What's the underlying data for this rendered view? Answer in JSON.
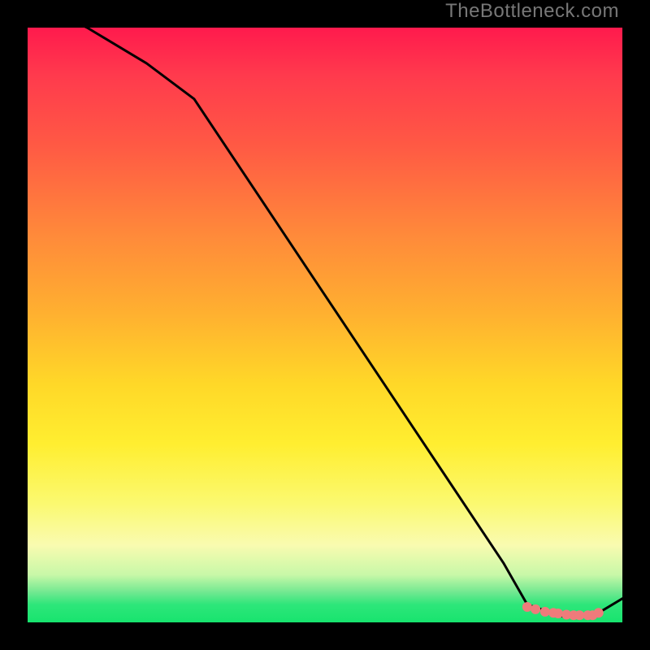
{
  "watermark": "TheBottleneck.com",
  "chart_data": {
    "type": "line",
    "title": "",
    "xlabel": "",
    "ylabel": "",
    "xlim": [
      0,
      100
    ],
    "ylim": [
      0,
      100
    ],
    "series": [
      {
        "name": "curve",
        "x": [
          0,
          10,
          20,
          28,
          40,
          50,
          60,
          70,
          80,
          84,
          90,
          95,
          100
        ],
        "y": [
          105,
          100,
          94,
          88,
          70,
          55,
          40,
          25,
          10,
          3,
          1,
          1,
          4
        ]
      }
    ],
    "highlight": {
      "dots_x": [
        84.0,
        85.4,
        87.0,
        88.4,
        89.2,
        90.6,
        91.8,
        92.8,
        94.2,
        95.0,
        96.0
      ],
      "dots_y": [
        2.6,
        2.2,
        1.8,
        1.6,
        1.5,
        1.3,
        1.2,
        1.2,
        1.2,
        1.2,
        1.6
      ],
      "dot_color": "#ef7b7b",
      "dot_radius_px": 6
    },
    "background_gradient": {
      "stops": [
        {
          "pos": 0.0,
          "color": "#ff1a4d"
        },
        {
          "pos": 0.35,
          "color": "#ff8a3a"
        },
        {
          "pos": 0.62,
          "color": "#ffe028"
        },
        {
          "pos": 0.86,
          "color": "#f9fbb0"
        },
        {
          "pos": 0.95,
          "color": "#6fe890"
        },
        {
          "pos": 1.0,
          "color": "#17e46e"
        }
      ]
    }
  }
}
